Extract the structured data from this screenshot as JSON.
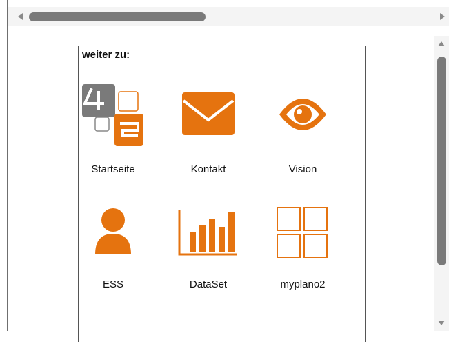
{
  "accent_color": "#e5730f",
  "panel": {
    "title": "weiter zu:"
  },
  "tiles": [
    {
      "label": "Startseite",
      "icon": "4plano-logo-icon"
    },
    {
      "label": "Kontakt",
      "icon": "envelope-icon"
    },
    {
      "label": "Vision",
      "icon": "eye-icon"
    },
    {
      "label": "ESS",
      "icon": "person-icon"
    },
    {
      "label": "DataSet",
      "icon": "bar-chart-icon"
    },
    {
      "label": "myplano2",
      "icon": "grid-icon"
    }
  ]
}
